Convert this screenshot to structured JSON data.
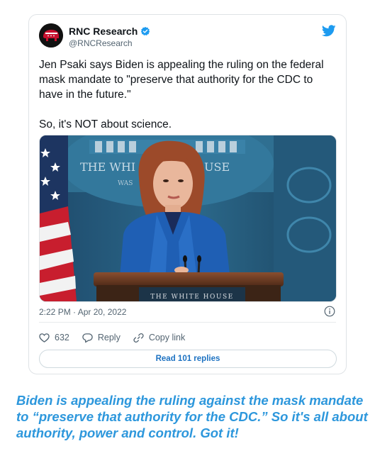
{
  "tweet": {
    "author_name": "RNC Research",
    "author_handle": "@RNCResearch",
    "text_line1": "Jen Psaki says Biden is appealing the ruling on the federal mask mandate to \"preserve that authority for the CDC to have in the future.\"",
    "text_line2": "So, it's NOT about science.",
    "timestamp": "2:22 PM · Apr 20, 2022",
    "media": {
      "seal_text_left": "THE WHI",
      "seal_text_right": "USE",
      "seal_subtext": "WAS",
      "podium_text": "THE WHITE HOUSE"
    },
    "actions": {
      "like_count": "632",
      "reply_label": "Reply",
      "copy_link_label": "Copy link"
    },
    "read_replies_label": "Read 101 replies"
  },
  "caption": " Biden is appealing the ruling against the mask mandate to “preserve that authority for the CDC.” So it's all about authority, power and control. Got it!",
  "colors": {
    "brand_blue": "#1d9bf0",
    "caption_blue": "#2d97dc",
    "link_blue": "#1d72c2",
    "avatar_red": "#c8102e"
  },
  "icons": {
    "avatar": "rnc-elephant-logo",
    "verified": "verified-badge-icon",
    "brand": "twitter-bird-icon",
    "info": "info-icon",
    "like": "heart-icon",
    "reply": "reply-bubble-icon",
    "copy": "link-icon"
  }
}
